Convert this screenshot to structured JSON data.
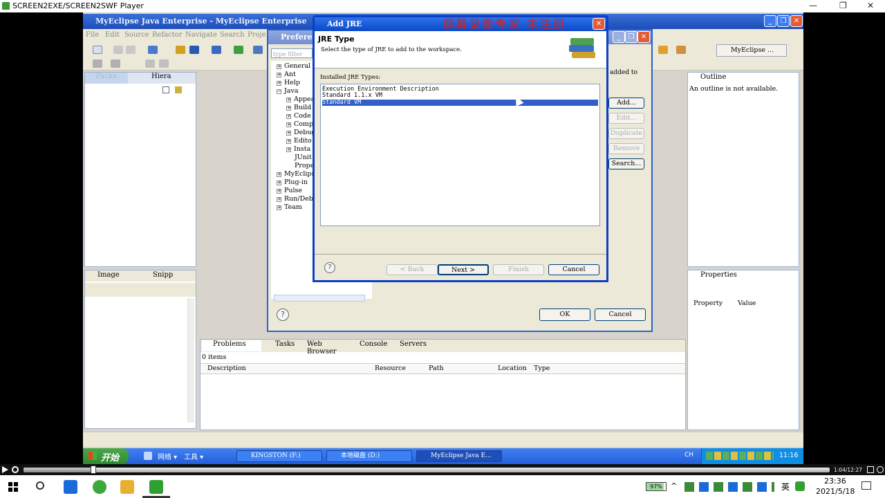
{
  "player": {
    "title": "SCREEN2EXE/SCREEN2SWF Player",
    "time": "1:04/12:27",
    "progress": 0.087
  },
  "ide": {
    "title": "MyEclipse Java Enterprise - MyEclipse Enterprise",
    "menu": [
      "File",
      "Edit",
      "Source",
      "Refactor",
      "Navigate",
      "Search",
      "Proje"
    ],
    "perspective": "MyEclipse ...",
    "left_tabs": [
      "Packa",
      "Hiera"
    ],
    "image_tabs": [
      "Image",
      "Snipp"
    ],
    "outline": {
      "tab": "Outline",
      "message": "An outline is not available."
    },
    "properties": {
      "tab": "Properties",
      "columns": [
        "Property",
        "Value"
      ]
    },
    "right_buttons": [
      "Add...",
      "Edit...",
      "Duplicate",
      "Remove",
      "Search..."
    ],
    "added_to": "added to",
    "bottom_tabs": [
      "Problems",
      "Tasks",
      "Web Browser",
      "Console",
      "Servers"
    ],
    "problems": {
      "count": "0 items",
      "columns": [
        "Description",
        "Resource",
        "Path",
        "Location",
        "Type"
      ]
    }
  },
  "prefs": {
    "title": "Prefere",
    "filter_placeholder": "type filter",
    "tree": [
      "General",
      "Ant",
      "Help",
      "Java",
      "Appea",
      "Build",
      "Code",
      "Compi",
      "Debug",
      "Edito",
      "Insta",
      "JUnit",
      "Prope",
      "MyEclips",
      "Plug-in",
      "Pulse",
      "Run/Debu",
      "Team"
    ],
    "ok": "OK",
    "cancel": "Cancel"
  },
  "jre": {
    "title": "Add JRE",
    "heading": "JRE Type",
    "description": "Select the type of JRE to add to the workspace.",
    "list_label": "Installed JRE Types:",
    "types": [
      "Execution Environment Description",
      "Standard 1.1.x VM",
      "Standard VM"
    ],
    "selected_index": 2,
    "back": "< Back",
    "next": "Next >",
    "finish": "Finish",
    "cancel": "Cancel"
  },
  "watermark": "屏幕录像专家 未注册",
  "xp_taskbar": {
    "start": "开始",
    "items": [
      "网络",
      "工具"
    ],
    "windows": [
      "KINGSTON (F:)",
      "本地磁盘 (D:)",
      "MyEclipse Java E..."
    ],
    "lang": "CH",
    "clock": "11:16"
  },
  "win_taskbar": {
    "battery": "97%",
    "ime": "英",
    "time": "23:36",
    "date": "2021/5/18"
  }
}
